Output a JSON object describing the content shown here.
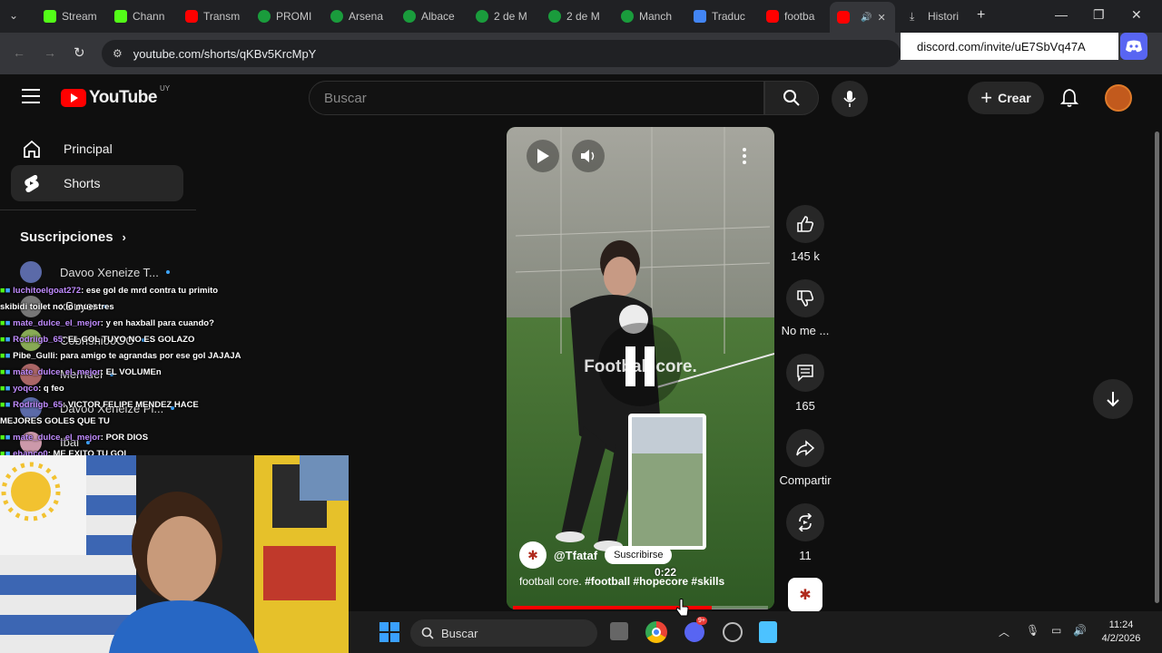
{
  "browser": {
    "tabs": [
      {
        "label": "Stream",
        "icon": "kick-icon"
      },
      {
        "label": "Chann",
        "icon": "kick-icon"
      },
      {
        "label": "Transm",
        "icon": "youtube-icon"
      },
      {
        "label": "PROMI",
        "icon": "football-icon"
      },
      {
        "label": "Arsena",
        "icon": "football-icon"
      },
      {
        "label": "Albace",
        "icon": "football-icon"
      },
      {
        "label": "2 de M",
        "icon": "football-icon"
      },
      {
        "label": "2 de M",
        "icon": "football-icon"
      },
      {
        "label": "Manch",
        "icon": "football-icon"
      },
      {
        "label": "Traduc",
        "icon": "translate-icon"
      },
      {
        "label": "footba",
        "icon": "youtube-icon"
      },
      {
        "label": "",
        "icon": "youtube-icon",
        "active": true
      },
      {
        "label": "Histori",
        "icon": "download-icon"
      }
    ],
    "url": "youtube.com/shorts/qKBv5KrcMpY",
    "popup_text": "discord.com/invite/uE7SbVq47A"
  },
  "youtube": {
    "logo_text": "YouTube",
    "country_code": "UY",
    "search_placeholder": "Buscar",
    "create_label": "Crear",
    "sidebar": {
      "items": [
        {
          "label": "Principal",
          "icon": "home-icon"
        },
        {
          "label": "Shorts",
          "icon": "shorts-icon",
          "active": true
        }
      ],
      "subscriptions_title": "Suscripciones",
      "subscriptions": [
        "Davoo Xeneize T...",
        "xBuyer",
        "CobrishiooOC",
        "Mernuel",
        "Davoo Xeneize Pl...",
        "Ibai"
      ]
    },
    "short": {
      "overlay_text": "Football core.",
      "channel": "@Tfataf",
      "subscribe_label": "Suscribirse",
      "timestamp": "0:22",
      "caption_plain": "football core.",
      "caption_tags": "#football #hopecore #skills",
      "progress": 0.78
    },
    "actions": {
      "likes": "145 k",
      "dislike_label": "No me ...",
      "comments": "165",
      "share_label": "Compartir",
      "remix": "11"
    }
  },
  "chat": [
    {
      "user": "luchitoelgoat272",
      "msg": ": ese gol de mrd contra tu primito",
      "cont": "skibidi toilet no lo muestres",
      "color": "purple"
    },
    {
      "user": "mate_dulce_el_mejor",
      "msg": ": y en haxball para cuando?",
      "color": "purple"
    },
    {
      "user": "Rodriigb_65",
      "msg": ": EL GOL TUYO NO ES GOLAZO",
      "color": "purple"
    },
    {
      "user": "Pibe_Gulli",
      "msg": ": para amigo te agrandas por ese gol JAJAJA",
      "color": "white"
    },
    {
      "user": "mate_dulce_el_mejor",
      "msg": ": EL VOLUMEn",
      "color": "purple"
    },
    {
      "user": "yoqco",
      "msg": ": q feo",
      "color": "purple"
    },
    {
      "user": "Rodriigb_65",
      "msg": ": VICTOR FELIPE MENDEZ HACE",
      "cont": "MEJORES GOLES QUE TU",
      "color": "purple"
    },
    {
      "user": "mate_dulce_el_mejor",
      "msg": ": POR DIOS",
      "color": "purple"
    },
    {
      "user": "ehanco0",
      "msg": ": ME EXITO TU GOL",
      "color": "purple"
    }
  ],
  "taskbar": {
    "search_placeholder": "Buscar",
    "time": "11:24",
    "date": "4/2/2026",
    "discord_badge": "9+"
  }
}
